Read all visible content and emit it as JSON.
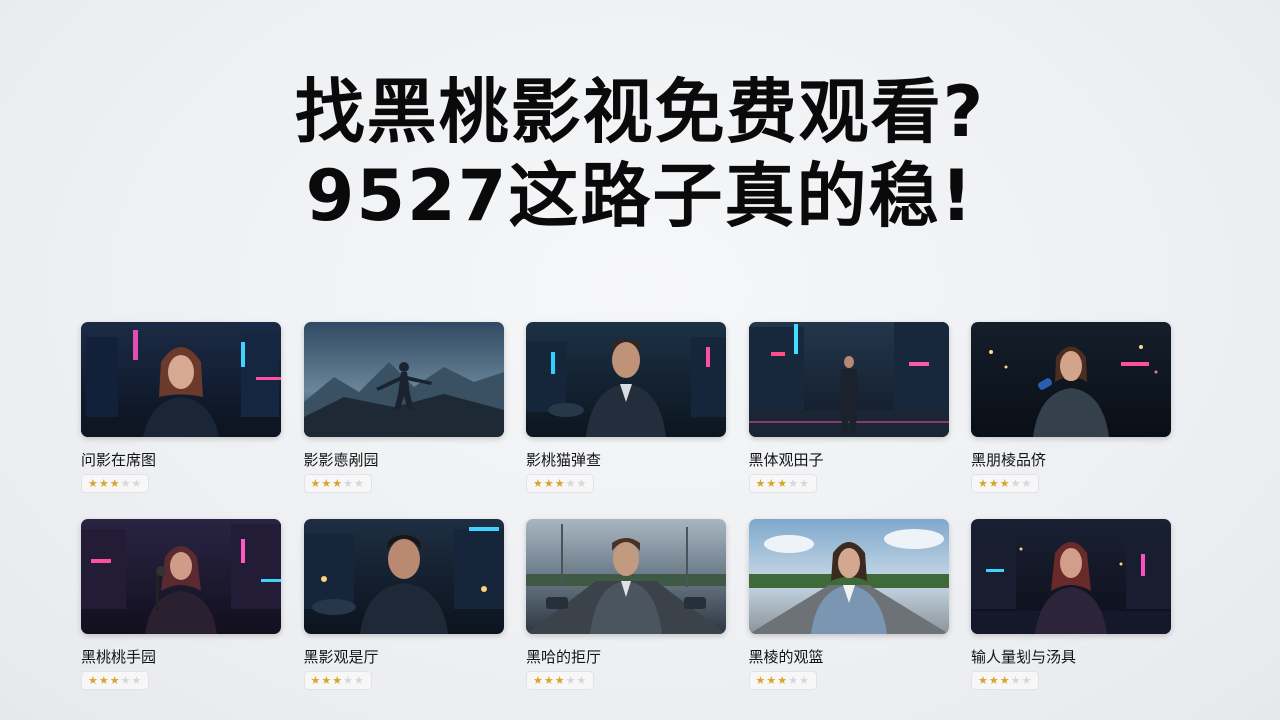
{
  "headline": {
    "line1": "找黑桃影视免费观看?",
    "line2": "9527这路子真的稳!"
  },
  "colors": {
    "text": "#0a0a0a",
    "star_on": "#d8a52a",
    "star_off": "#d6d7da",
    "background": "#eef0f3"
  },
  "cards": [
    {
      "title": "问影在席图",
      "rating": 3,
      "max": 5,
      "scene": "neon-city-woman"
    },
    {
      "title": "影影㥁剐园",
      "rating": 3,
      "max": 5,
      "scene": "mountain-silhouette"
    },
    {
      "title": "影桃猫弹查",
      "rating": 3,
      "max": 5,
      "scene": "neon-city-man"
    },
    {
      "title": "黑体观田子",
      "rating": 3,
      "max": 5,
      "scene": "neon-street-man"
    },
    {
      "title": "黑朋棱品侪",
      "rating": 3,
      "max": 5,
      "scene": "night-woman-mic"
    },
    {
      "title": "黑桃桃手园",
      "rating": 3,
      "max": 5,
      "scene": "neon-woman-mic"
    },
    {
      "title": "黑影观是厅",
      "rating": 3,
      "max": 5,
      "scene": "night-city-man"
    },
    {
      "title": "黑哈的拒厅",
      "rating": 3,
      "max": 5,
      "scene": "highway-man"
    },
    {
      "title": "黑棱的观篮",
      "rating": 3,
      "max": 5,
      "scene": "road-woman-day"
    },
    {
      "title": "输人量刬与汤具",
      "rating": 3,
      "max": 5,
      "scene": "neon-woman-street"
    }
  ]
}
